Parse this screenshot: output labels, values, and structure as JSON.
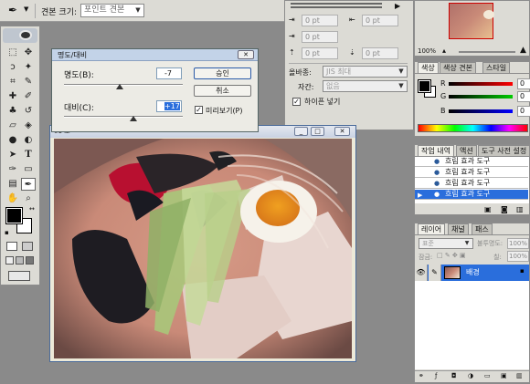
{
  "options_bar": {
    "brush_size_label": "견본 크기:",
    "brush_size_value": "포인트 견본"
  },
  "paragraph_panel": {
    "fields": [
      "0 pt",
      "0 pt",
      "0 pt",
      "0 pt",
      "0 pt"
    ],
    "mojikumi_label": "올바종:",
    "mojikumi_value": "JIS 최대",
    "kinsoku_label": "자간:",
    "kinsoku_value": "없음",
    "hyphenate_label": "하이픈 넣기"
  },
  "dialog": {
    "title": "명도/대비",
    "brightness_label": "명도(B):",
    "brightness_value": "-7",
    "brightness": -7,
    "contrast_label": "대비(C):",
    "contrast_value": "+17",
    "contrast": 17,
    "ok": "승인",
    "cancel": "취소",
    "preview": "미리보기(P)"
  },
  "image_window": {
    "title": "01 포"
  },
  "navigator": {
    "zoom": "100%"
  },
  "color_panel": {
    "tabs": [
      "색상",
      "색상 견본",
      "스타일"
    ],
    "channels": [
      {
        "label": "R",
        "value": "0"
      },
      {
        "label": "G",
        "value": "0"
      },
      {
        "label": "B",
        "value": "0"
      }
    ]
  },
  "history_panel": {
    "tabs": [
      "작업 내역",
      "액션",
      "도구 사전 설정"
    ],
    "items": [
      "흐림 효과 도구",
      "흐림 효과 도구",
      "흐림 효과 도구",
      "흐림 효과 도구"
    ]
  },
  "layers_panel": {
    "tabs": [
      "레이어",
      "채널",
      "패스"
    ],
    "blend_mode": "표준",
    "opacity_label": "불투명도:",
    "opacity_value": "100%",
    "lock_label": "잠금:",
    "fill_label": "칠:",
    "fill_value": "100%",
    "layer_name": "배경"
  },
  "colors": {
    "accent": "#2a6edc",
    "dialog_title": "#c3d3e8",
    "panel_bg": "#dcdbd5",
    "workspace": "#8a8a8a"
  }
}
